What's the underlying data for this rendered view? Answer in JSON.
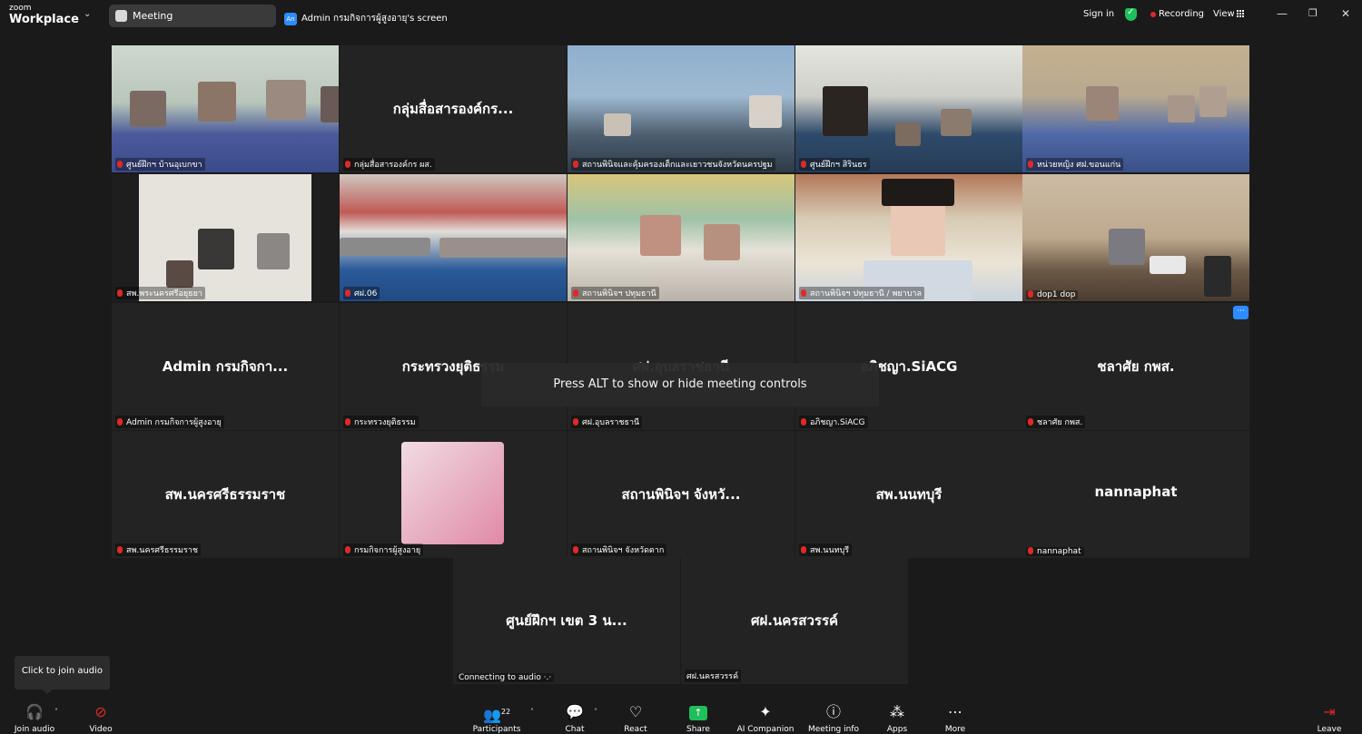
{
  "app": {
    "logo_small": "zoom",
    "logo_big": "Workplace",
    "meeting_tab": "Meeting",
    "share_tab_avatar": "An",
    "share_tab": "Admin กรมกิจการผู้สูงอายุ's screen",
    "sign_in": "Sign in",
    "recording": "Recording",
    "view": "View"
  },
  "tiles": [
    {
      "type": "video",
      "label": "ศูนย์ฝึกฯ บ้านอุเบกขา",
      "scene": "classroom-green"
    },
    {
      "type": "name",
      "name": "กลุ่มสื่อสารองค์กร...",
      "label": "กลุ่มสื่อสารองค์กร ผส."
    },
    {
      "type": "video",
      "label": "สถานพินิจและคุ้มครองเด็กและเยาวชนจังหวัดนครปฐม",
      "scene": "meeting-room"
    },
    {
      "type": "video",
      "label": "ศูนย์ฝึกฯ สิรินธร",
      "scene": "hall-dark"
    },
    {
      "type": "video",
      "label": "หน่วยหญิง ศฝ.ขอนแก่น",
      "scene": "workshop"
    },
    {
      "type": "video",
      "label": "สพ.พระนครศรีอยุธยา",
      "scene": "room-white"
    },
    {
      "type": "video",
      "label": "ศฝ.06",
      "scene": "auditorium"
    },
    {
      "type": "video",
      "label": "สถานพินิจฯ ปทุมธานี",
      "scene": "classroom-color"
    },
    {
      "type": "video",
      "label": "สถานพินิจฯ ปทุมธานี / พยาบาล",
      "scene": "woman"
    },
    {
      "type": "video",
      "label": "dop1 dop",
      "scene": "office-desk",
      "active": true
    },
    {
      "type": "name",
      "name": "Admin กรมกิจกา...",
      "label": "Admin กรมกิจการผู้สูงอายุ"
    },
    {
      "type": "name",
      "name": "กระทรวงยุติธรรม",
      "label": "กระทรวงยุติธรรม"
    },
    {
      "type": "name",
      "name": "ศฝ.อุบลราชธานี",
      "label": "ศฝ.อุบลราชธานี"
    },
    {
      "type": "name",
      "name": "อภิชญา.SiACG",
      "label": "อภิชญา.SiACG"
    },
    {
      "type": "name",
      "name": "ชลาศัย กพส.",
      "label": "ชลาศัย กพส."
    },
    {
      "type": "name",
      "name": "สพ.นครศรีธรรมราช",
      "label": "สพ.นครศรีธรรมราช"
    },
    {
      "type": "avatar",
      "label": "กรมกิจการผู้สูงอายุ"
    },
    {
      "type": "name",
      "name": "สถานพินิจฯ จังหวั...",
      "label": "สถานพินิจฯ จังหวัดตาก"
    },
    {
      "type": "name",
      "name": "สพ.นนทบุรี",
      "label": "สพ.นนทบุรี"
    },
    {
      "type": "name",
      "name": "nannaphat",
      "label": "nannaphat"
    },
    {
      "type": "name",
      "name": "ศูนย์ฝึกฯ เขต 3 น...",
      "label": "Connecting to audio ·.·",
      "nomute": true
    },
    {
      "type": "name",
      "name": "ศฝ.นครสวรรค์",
      "label": "ศฝ.นครสวรรค์",
      "nomute": true
    }
  ],
  "overlay": {
    "hint": "Press ALT to show or hide meeting controls",
    "tooltip": "Click to join audio",
    "more": "···"
  },
  "toolbar": {
    "join_audio": "Join audio",
    "video": "Video",
    "participants": "Participants",
    "participants_count": "22",
    "chat": "Chat",
    "react": "React",
    "share": "Share",
    "ai_companion": "AI Companion",
    "meeting_info": "Meeting info",
    "apps": "Apps",
    "more": "More",
    "leave": "Leave"
  },
  "colors": {
    "active_speaker": "#23d96b",
    "accent": "#2d8cff",
    "share_green": "#1fbf5b",
    "muted_red": "#e02828"
  }
}
